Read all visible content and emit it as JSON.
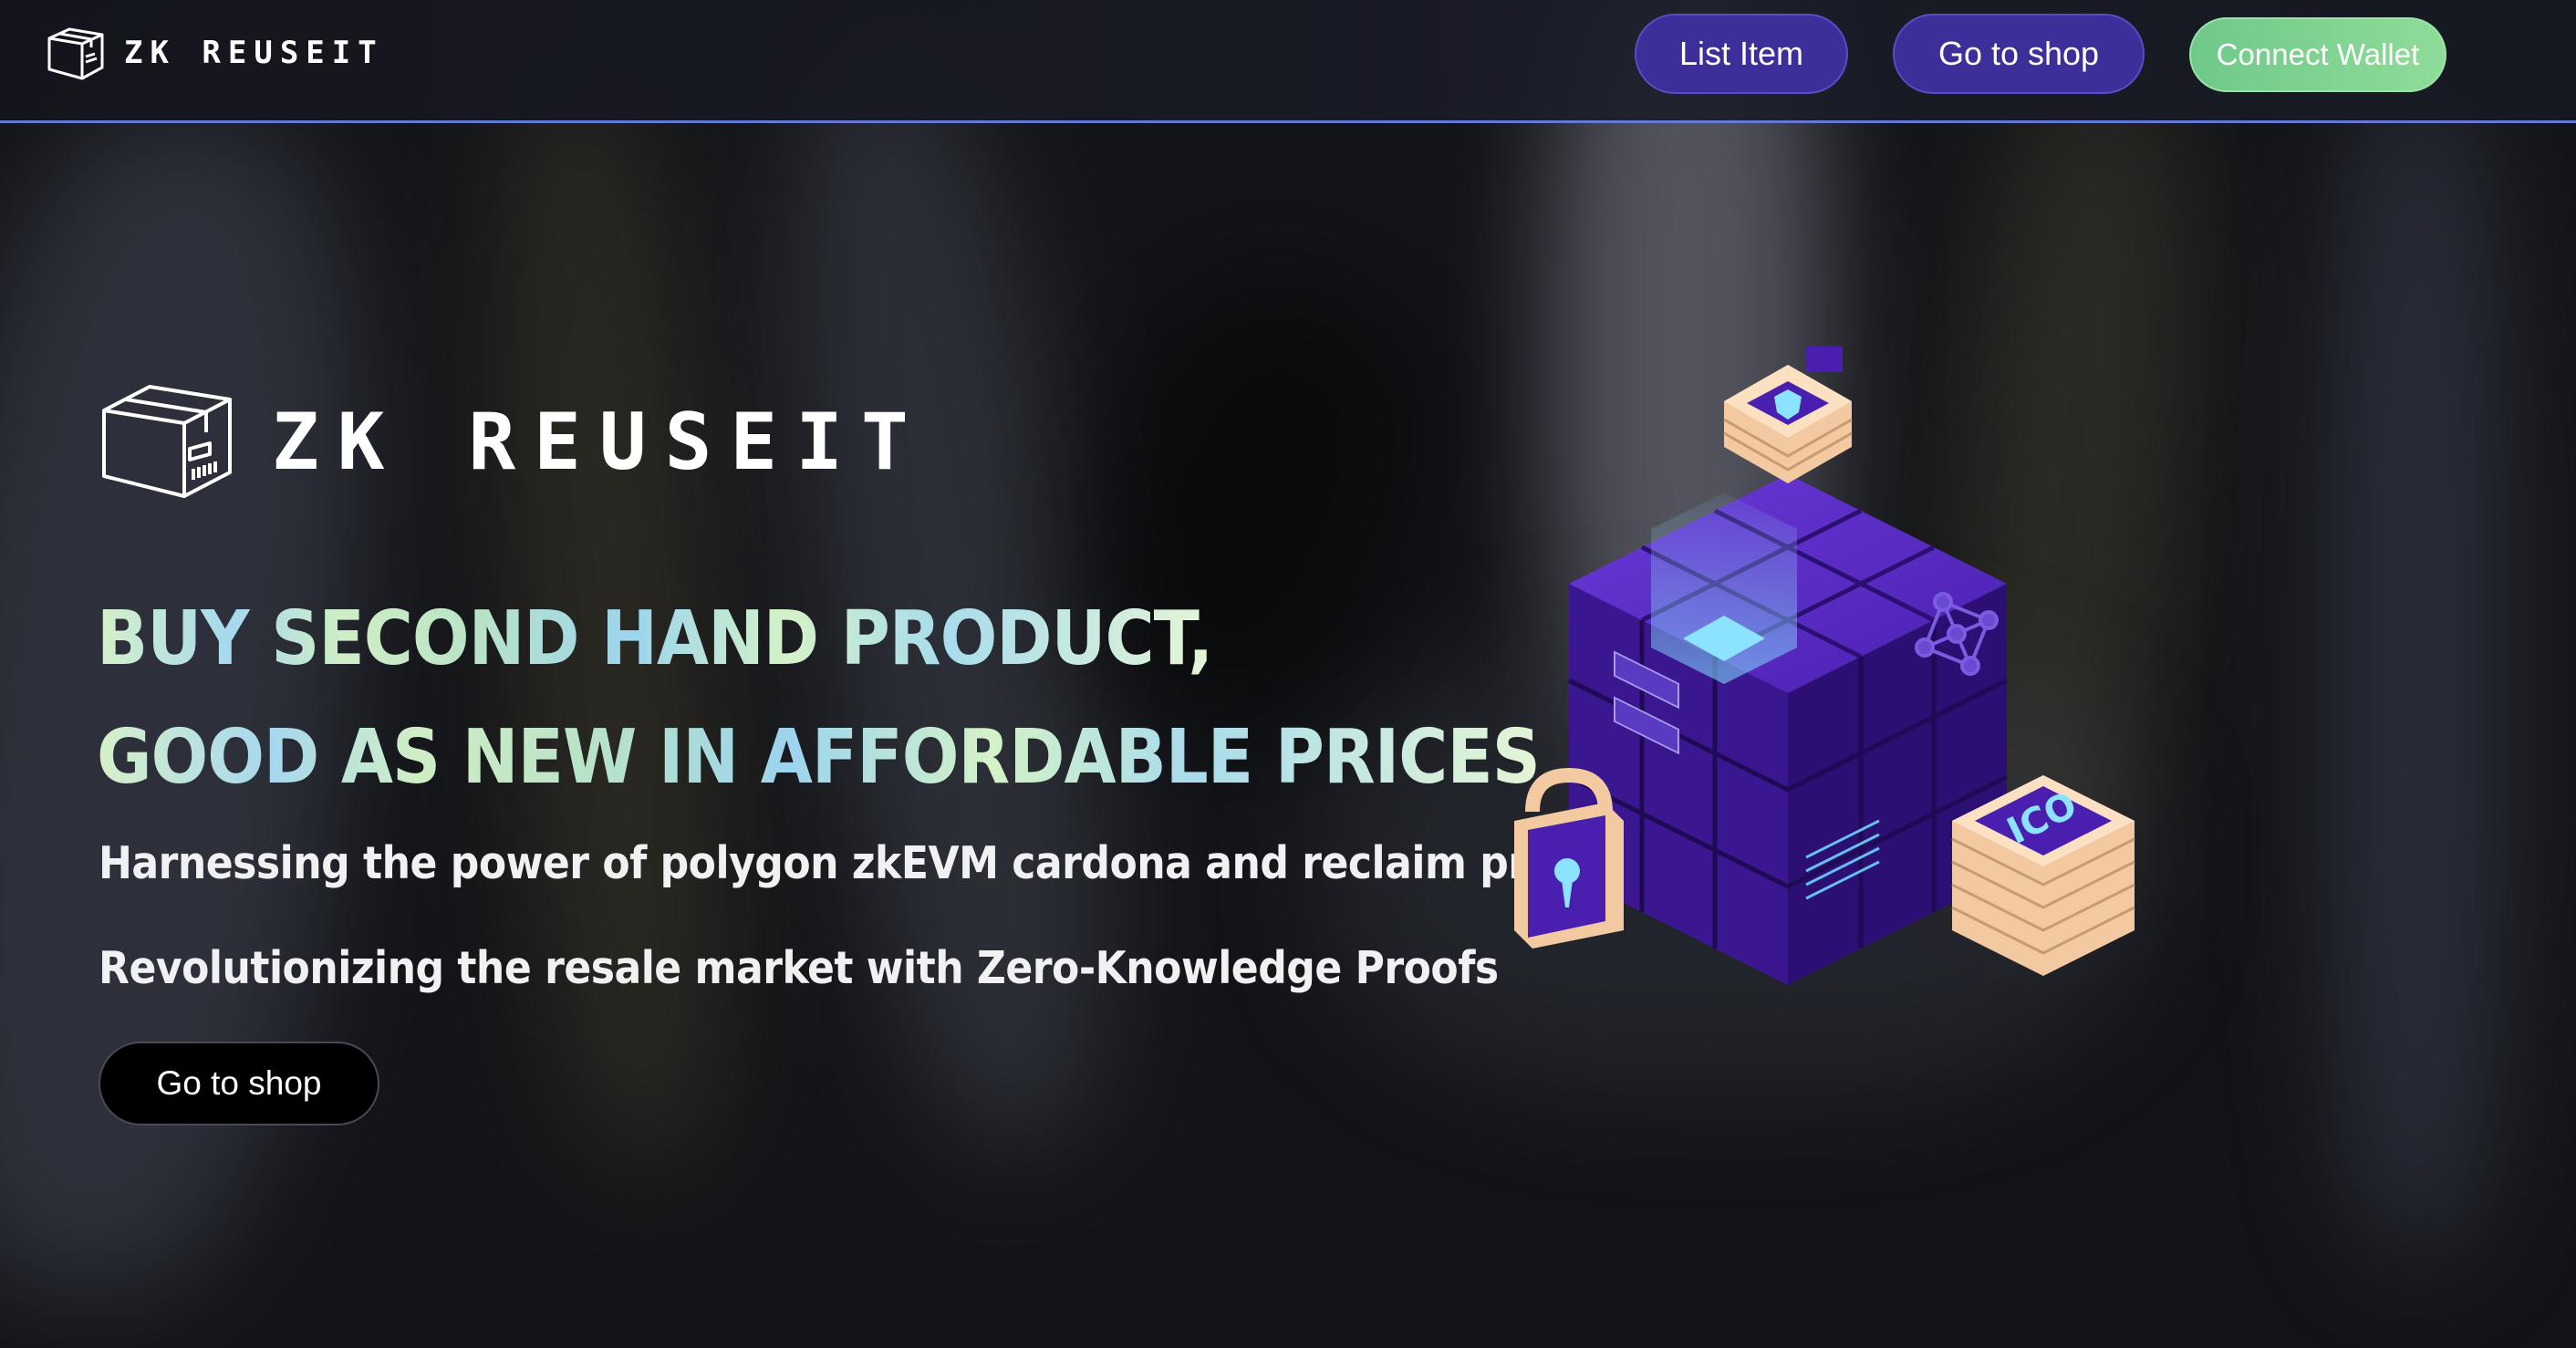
{
  "brand": {
    "name": "ZK REUSEIT",
    "logo_icon": "box-icon"
  },
  "nav": {
    "list_item_label": "List Item",
    "go_to_shop_label": "Go to shop",
    "connect_wallet_label": "Connect Wallet"
  },
  "hero": {
    "logo_text": "ZK REUSEIT",
    "headline_line1": "BUY SECOND HAND PRODUCT,",
    "headline_line2": "GOOD AS NEW IN AFFORDABLE PRICES",
    "subtitle1": "Harnessing the power of polygon zkEVM cardona and reclaim protocol",
    "subtitle2": "Revolutionizing the resale market with Zero-Knowledge Proofs",
    "cta_label": "Go to shop",
    "illustration_badge": "ICO",
    "illustration_icon": "blockchain-cube-illustration"
  },
  "colors": {
    "background": "#131418",
    "nav_accent_line": "#6478d8",
    "button_purple": "#3d2f9a",
    "wallet_green": "#7fd38f",
    "headline_gradient": [
      "#d6f0c8",
      "#a6d8ef",
      "#e5f5d6"
    ],
    "cube_purple": "#4b1fa8",
    "accent_peach": "#f2c9a0"
  }
}
